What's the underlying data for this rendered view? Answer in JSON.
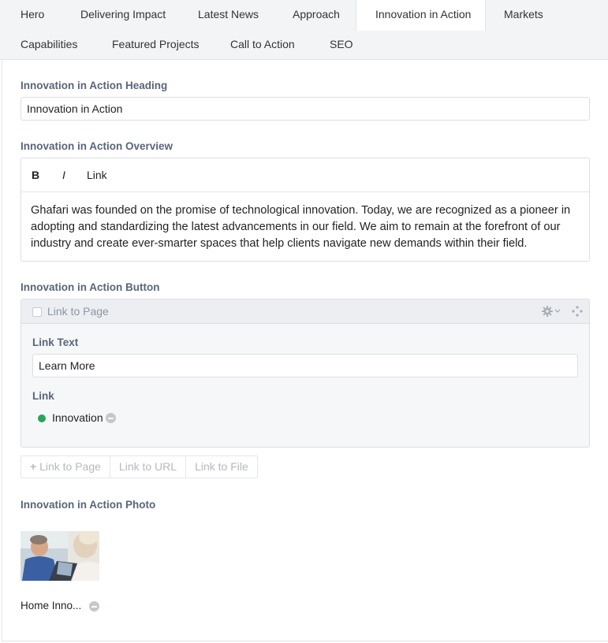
{
  "tabs": [
    {
      "label": "Hero"
    },
    {
      "label": "Delivering Impact"
    },
    {
      "label": "Latest News"
    },
    {
      "label": "Approach"
    },
    {
      "label": "Innovation in Action"
    },
    {
      "label": "Markets"
    },
    {
      "label": "Capabilities"
    },
    {
      "label": "Featured Projects"
    },
    {
      "label": "Call to Action"
    },
    {
      "label": "SEO"
    }
  ],
  "active_tab": "Innovation in Action",
  "heading_field": {
    "label": "Innovation in Action Heading",
    "value": "Innovation in Action"
  },
  "overview_field": {
    "label": "Innovation in Action Overview",
    "toolbar": {
      "bold": "B",
      "italic": "I",
      "link": "Link"
    },
    "value": "Ghafari was founded on the promise of technological innovation. Today, we are recognized as a pioneer in adopting and standardizing the latest advancements in our field. We aim to remain at the forefront of our industry and create ever-smarter spaces that help clients navigate new demands within their field."
  },
  "button_field": {
    "label": "Innovation in Action Button",
    "block": {
      "title": "Link to Page",
      "link_text_label": "Link Text",
      "link_text_value": "Learn More",
      "link_label": "Link",
      "link_value": "Innovation",
      "link_status_color": "#27a558"
    },
    "add_buttons": {
      "page": "Link to Page",
      "url": "Link to URL",
      "file": "Link to File"
    }
  },
  "photo_field": {
    "label": "Innovation in Action Photo",
    "filename": "Home Inno..."
  },
  "colors": {
    "label": "#596579",
    "border": "#dcdee3",
    "tab_bar": "#f3f4f6"
  }
}
